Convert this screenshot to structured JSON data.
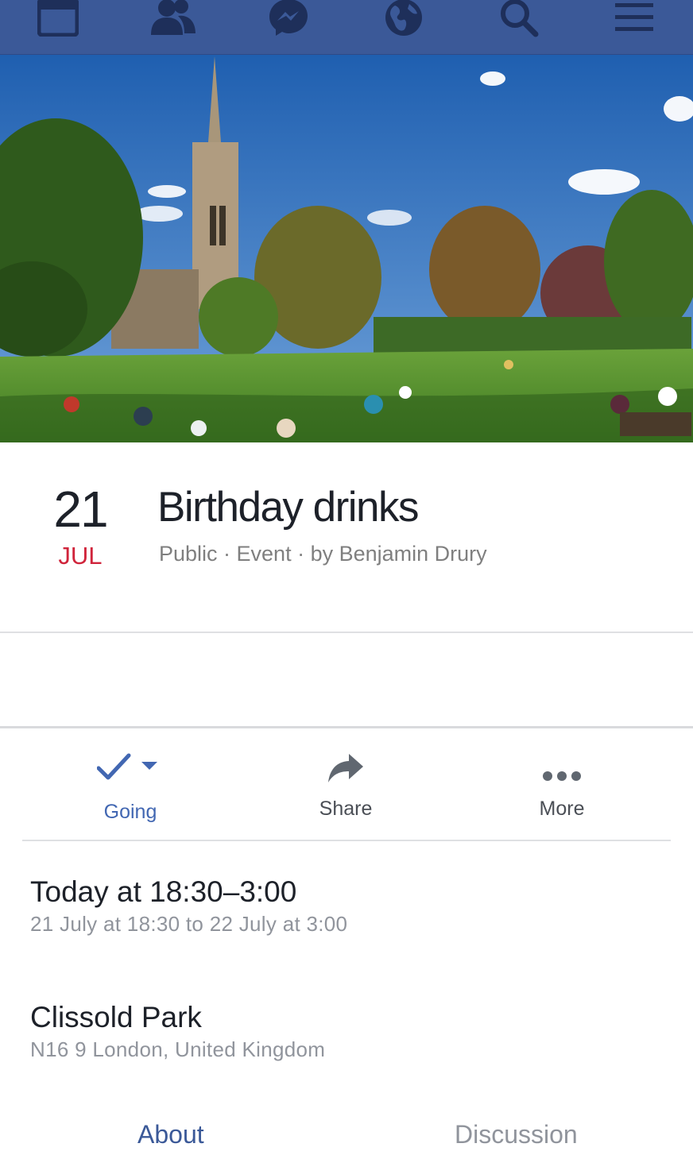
{
  "nav": {
    "items": [
      {
        "name": "news-feed-icon"
      },
      {
        "name": "friends-icon"
      },
      {
        "name": "messenger-icon"
      },
      {
        "name": "globe-icon"
      },
      {
        "name": "search-icon"
      },
      {
        "name": "menu-icon"
      }
    ],
    "bar_color": "#3b5998"
  },
  "event": {
    "day": "21",
    "month": "JUL",
    "title": "Birthday drinks",
    "meta": "Public · Event · by Benjamin Drury"
  },
  "actions": {
    "going_label": "Going",
    "share_label": "Share",
    "more_label": "More"
  },
  "details": {
    "time_primary": "Today at 18:30–3:00",
    "time_secondary": "21 July at 18:30 to 22 July at 3:00",
    "location_primary": "Clissold Park",
    "location_secondary": "N16 9 London, United Kingdom"
  },
  "tabs": {
    "about": "About",
    "discussion": "Discussion"
  },
  "colors": {
    "brand": "#3b5998",
    "accent_blue": "#4267b2",
    "date_red": "#d0243b",
    "secondary_text": "#90949c"
  }
}
